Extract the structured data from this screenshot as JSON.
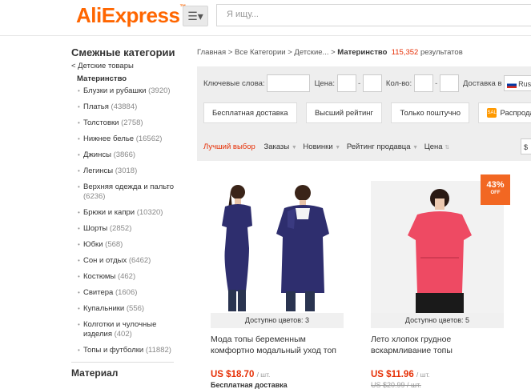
{
  "header": {
    "logo": "AliExpress",
    "search_placeholder": "Я ищу..."
  },
  "sidebar": {
    "title": "Смежные категории",
    "back_link": "< Детские товары",
    "current": "Материнство",
    "items": [
      {
        "label": "Блузки и рубашки",
        "count": "(3920)"
      },
      {
        "label": "Платья",
        "count": "(43884)"
      },
      {
        "label": "Толстовки",
        "count": "(2758)"
      },
      {
        "label": "Нижнее белье",
        "count": "(16562)"
      },
      {
        "label": "Джинсы",
        "count": "(3866)"
      },
      {
        "label": "Легинсы",
        "count": "(3018)"
      },
      {
        "label": "Верхняя одежда и пальто",
        "count": "(6236)"
      },
      {
        "label": "Брюки и капри",
        "count": "(10320)"
      },
      {
        "label": "Шорты",
        "count": "(2852)"
      },
      {
        "label": "Юбки",
        "count": "(568)"
      },
      {
        "label": "Сон и отдых",
        "count": "(6462)"
      },
      {
        "label": "Костюмы",
        "count": "(462)"
      },
      {
        "label": "Свитера",
        "count": "(1606)"
      },
      {
        "label": "Купальники",
        "count": "(556)"
      },
      {
        "label": "Колготки и чулочные изделия",
        "count": "(402)"
      },
      {
        "label": "Топы и футболки",
        "count": "(11882)"
      }
    ],
    "next_section": "Материал"
  },
  "breadcrumb": {
    "path": "Главная > Все Категории > Детские... >",
    "current": "Материнство",
    "count": "115,352",
    "results": "результатов"
  },
  "filters": {
    "keywords_label": "Ключевые слова:",
    "price_label": "Цена:",
    "qty_label": "Кол-во:",
    "deliver_label": "Доставка в",
    "deliver_value": "Russ",
    "tags": [
      "Бесплатная доставка",
      "Высший рейтинг",
      "Только поштучно",
      "Распродажа"
    ],
    "sale_icon": "SALE",
    "sort": {
      "best": "Лучший выбор",
      "orders": "Заказы",
      "new": "Новинки",
      "seller": "Рейтинг продавца",
      "price": "Цена"
    },
    "currency": "$"
  },
  "products": [
    {
      "colors": "Доступно цветов: 3",
      "title": "Мода топы беременным комфортно модальный уход топ",
      "price": "US $18.70",
      "unit": "/ шт.",
      "shipping": "Бесплатная доставка"
    },
    {
      "colors": "Доступно цветов: 5",
      "title": "Лето хлопок грудное вскармливание топы",
      "price": "US $11.96",
      "unit": "/ шт.",
      "old_price": "US $20.99 / шт.",
      "discount": "43%",
      "discount_off": "OFF"
    }
  ]
}
